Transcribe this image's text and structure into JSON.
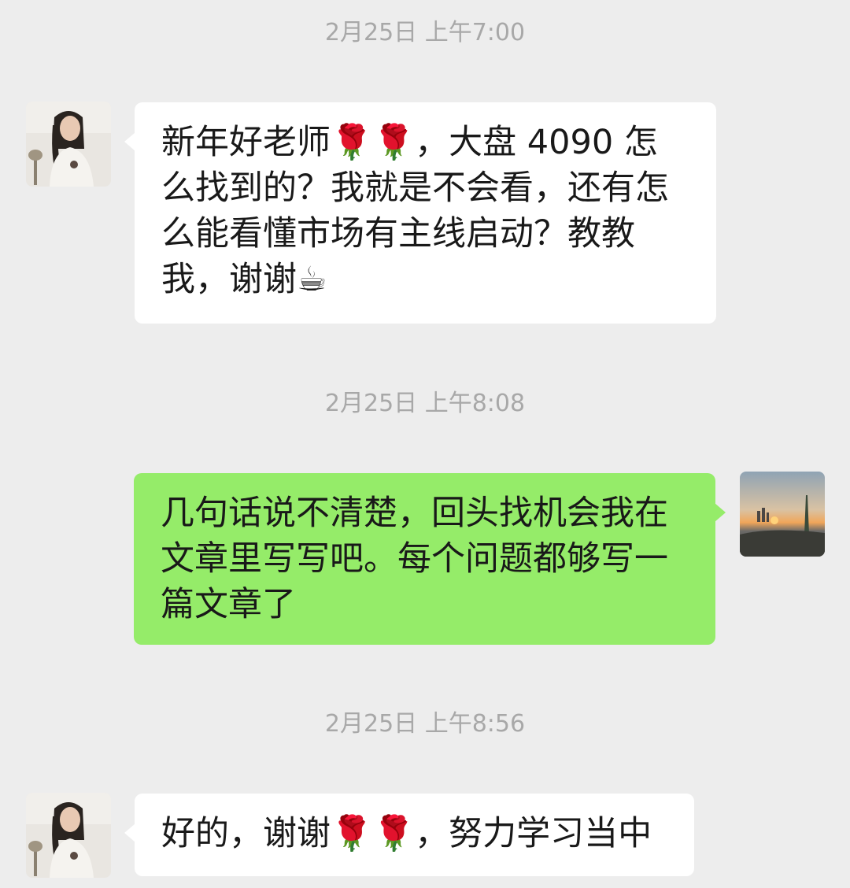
{
  "messages": [
    {
      "timestamp": "2月25日 上午7:00",
      "sender": "incoming",
      "text": "新年好老师🌹🌹，大盘 4090 怎么找到的？我就是不会看，还有怎么能看懂市场有主线启动？教教我，谢谢☕"
    },
    {
      "timestamp": "2月25日 上午8:08",
      "sender": "outgoing",
      "text": "几句话说不清楚，回头找机会我在文章里写写吧。每个问题都够写一篇文章了"
    },
    {
      "timestamp": "2月25日 上午8:56",
      "sender": "incoming",
      "text": "好的，谢谢🌹🌹，努力学习当中"
    }
  ],
  "colors": {
    "background": "#ededed",
    "incoming_bubble": "#ffffff",
    "outgoing_bubble": "#95ec69",
    "timestamp_text": "#a8a8a8",
    "message_text": "#191919"
  },
  "icons": {
    "incoming_avatar": "woman-portrait-avatar",
    "outgoing_avatar": "sunset-landscape-avatar"
  }
}
